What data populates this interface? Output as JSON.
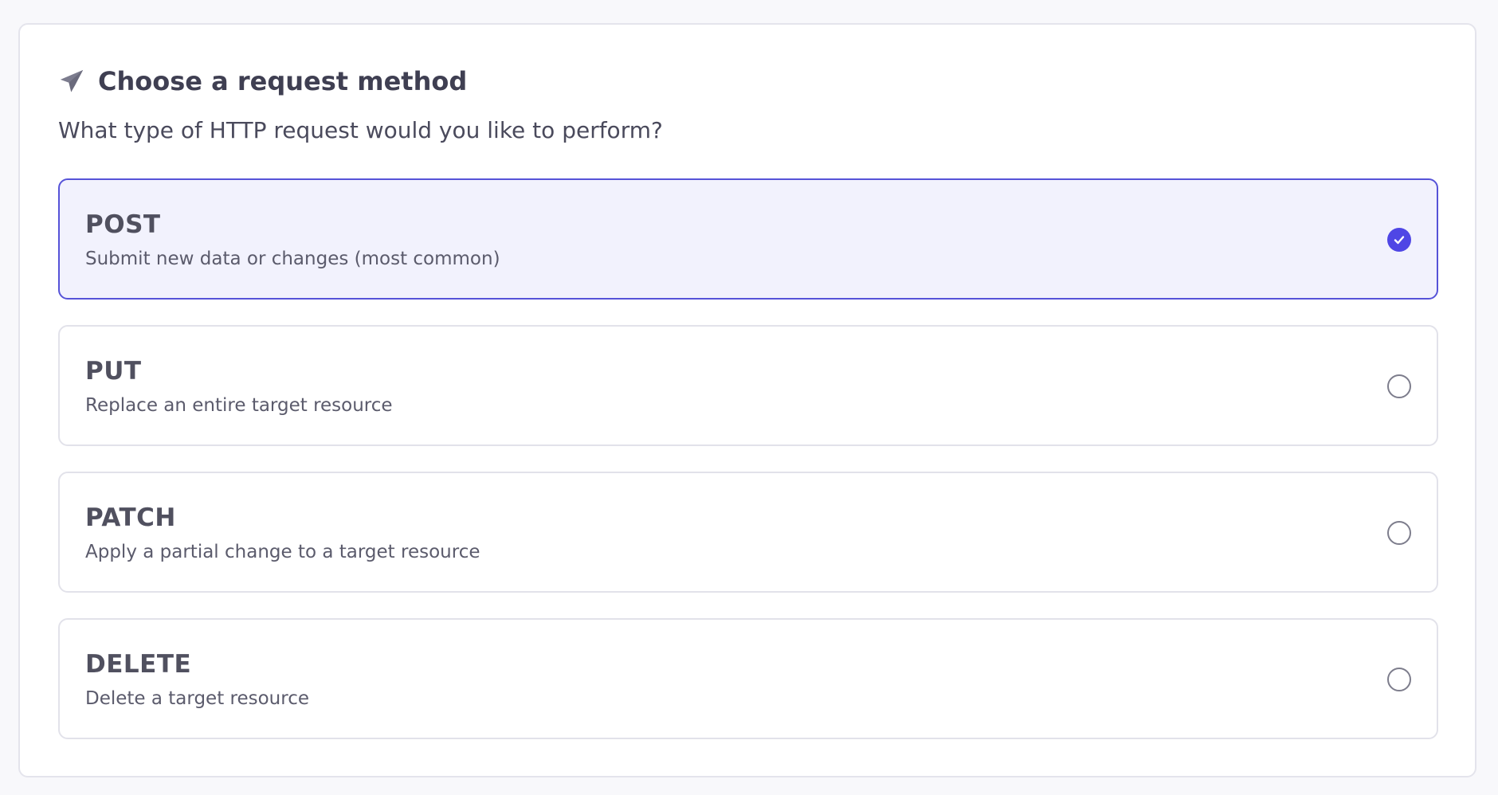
{
  "header": {
    "icon": "paper-plane-icon",
    "title": "Choose a request method",
    "subtitle": "What type of HTTP request would you like to perform?"
  },
  "colors": {
    "accent": "#4f46e5",
    "selected_background": "#f2f2fd",
    "border": "#e2e2ea"
  },
  "methods": [
    {
      "name": "POST",
      "description": "Submit new data or changes (most common)",
      "selected": true
    },
    {
      "name": "PUT",
      "description": "Replace an entire target resource",
      "selected": false
    },
    {
      "name": "PATCH",
      "description": "Apply a partial change to a target resource",
      "selected": false
    },
    {
      "name": "DELETE",
      "description": "Delete a target resource",
      "selected": false
    }
  ]
}
